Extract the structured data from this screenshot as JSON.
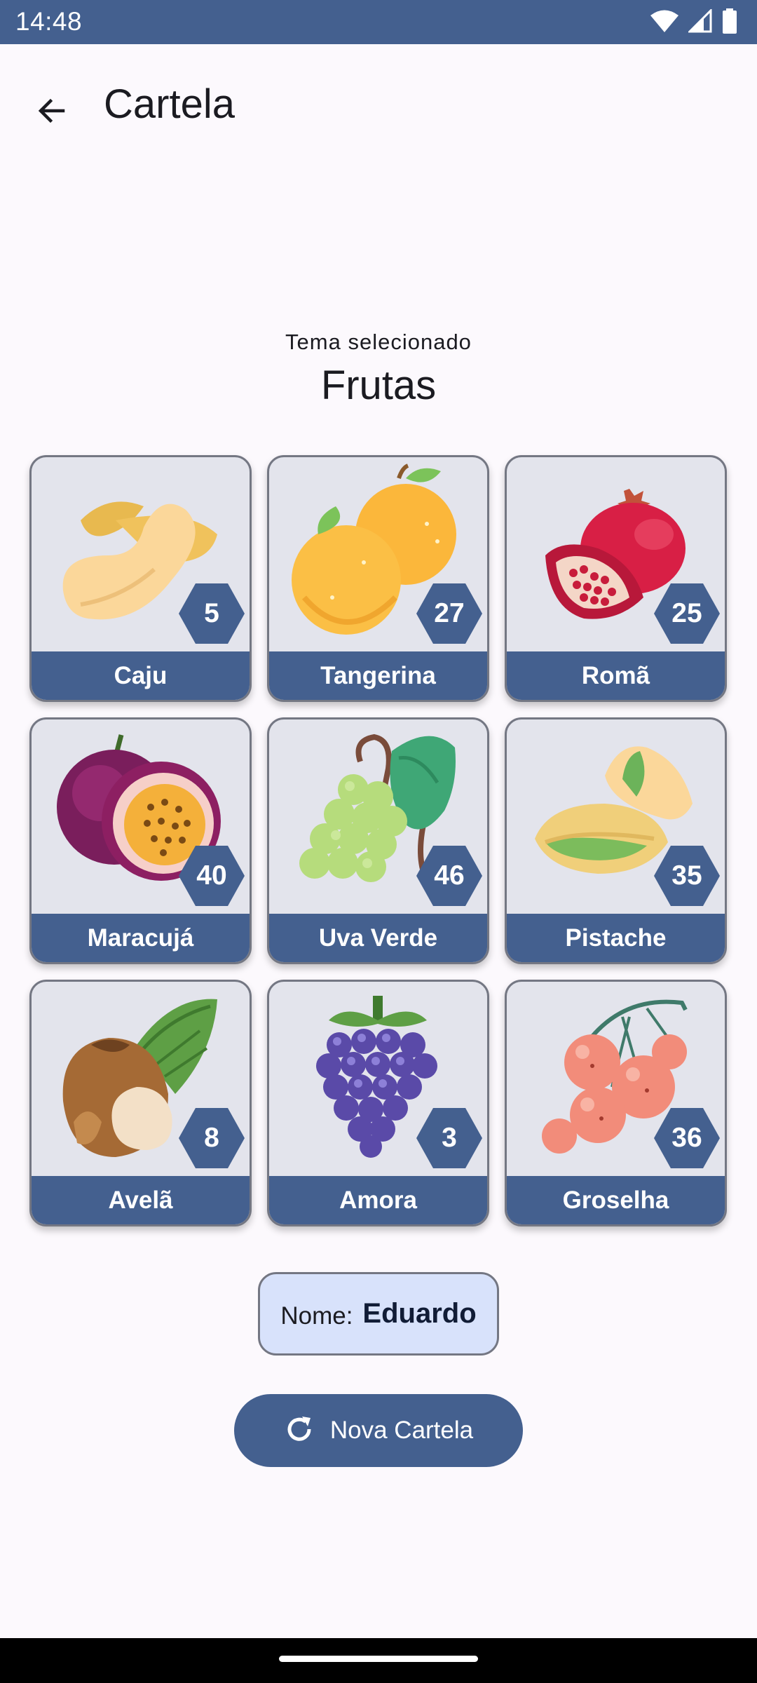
{
  "status": {
    "time": "14:48",
    "icons": [
      "wifi-icon",
      "signal-icon",
      "battery-icon"
    ]
  },
  "appbar": {
    "title": "Cartela",
    "back_icon": "arrow-back-icon"
  },
  "theme": {
    "label": "Tema selecionado",
    "name": "Frutas"
  },
  "cards": [
    {
      "label": "Caju",
      "number": "5",
      "icon": "cashew-icon"
    },
    {
      "label": "Tangerina",
      "number": "27",
      "icon": "tangerine-icon"
    },
    {
      "label": "Romã",
      "number": "25",
      "icon": "pomegranate-icon"
    },
    {
      "label": "Maracujá",
      "number": "40",
      "icon": "passion-fruit-icon"
    },
    {
      "label": "Uva Verde",
      "number": "46",
      "icon": "green-grape-icon"
    },
    {
      "label": "Pistache",
      "number": "35",
      "icon": "pistachio-icon"
    },
    {
      "label": "Avelã",
      "number": "8",
      "icon": "hazelnut-icon"
    },
    {
      "label": "Amora",
      "number": "3",
      "icon": "blackberry-icon"
    },
    {
      "label": "Groselha",
      "number": "36",
      "icon": "currant-icon"
    }
  ],
  "player": {
    "label": "Nome:",
    "name": "Eduardo"
  },
  "actions": {
    "new_card_label": "Nova Cartela",
    "new_card_icon": "refresh-icon"
  },
  "colors": {
    "primary": "#44608f",
    "card_bg": "#e3e4ec",
    "name_bg": "#d8e2fb",
    "background": "#fcf9fd"
  }
}
